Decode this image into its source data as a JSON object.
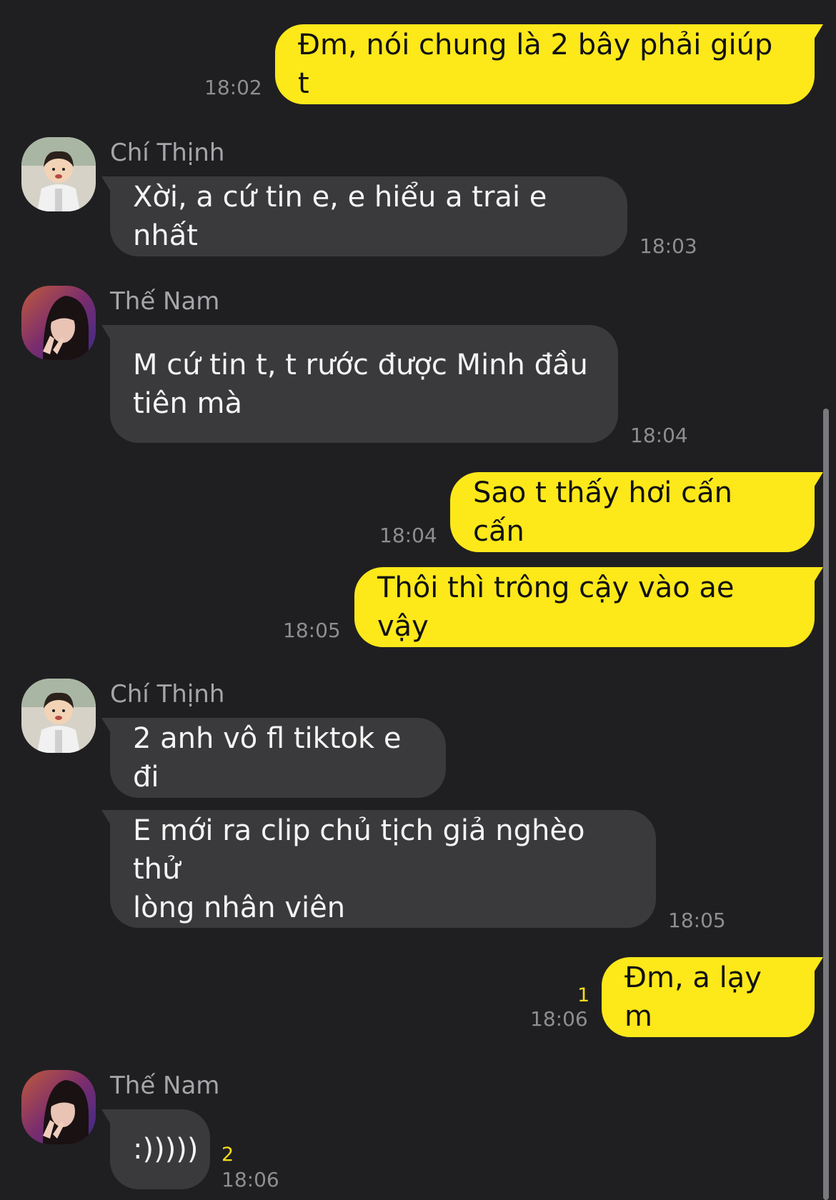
{
  "messages": [
    {
      "from": "me",
      "text": "Đm, nói chung là 2 bây phải giúp t",
      "time": "18:02"
    },
    {
      "from": "them",
      "sender": "Chí Thịnh",
      "avatar": "boy-avatar",
      "text": "Xời, a cứ tin e, e hiểu a trai e nhất",
      "time": "18:03"
    },
    {
      "from": "them",
      "sender": "Thế Nam",
      "avatar": "girl-avatar",
      "text": "M cứ tin t, t rước được Minh đầu\ntiên mà",
      "time": "18:04"
    },
    {
      "from": "me",
      "text": "Sao t thấy hơi cấn cấn",
      "time": "18:04"
    },
    {
      "from": "me",
      "text": "Thôi thì trông cậy vào ae vậy",
      "time": "18:05"
    },
    {
      "from": "them",
      "sender": "Chí Thịnh",
      "avatar": "boy-avatar",
      "text": "2 anh vô fl tiktok e đi"
    },
    {
      "from": "them",
      "text": "E mới ra clip chủ tịch giả nghèo thử\nlòng nhân viên",
      "time": "18:05"
    },
    {
      "from": "me",
      "text": "Đm, a lạy m",
      "time": "18:06",
      "unread": "1"
    },
    {
      "from": "them",
      "sender": "Thế Nam",
      "avatar": "girl-avatar",
      "text": ":)))))",
      "time": "18:06",
      "unread": "2"
    }
  ],
  "colors": {
    "background": "#1f1f21",
    "my_bubble": "#fde81a",
    "their_bubble": "#3a3a3c",
    "unread_count": "#f5dc1a"
  }
}
